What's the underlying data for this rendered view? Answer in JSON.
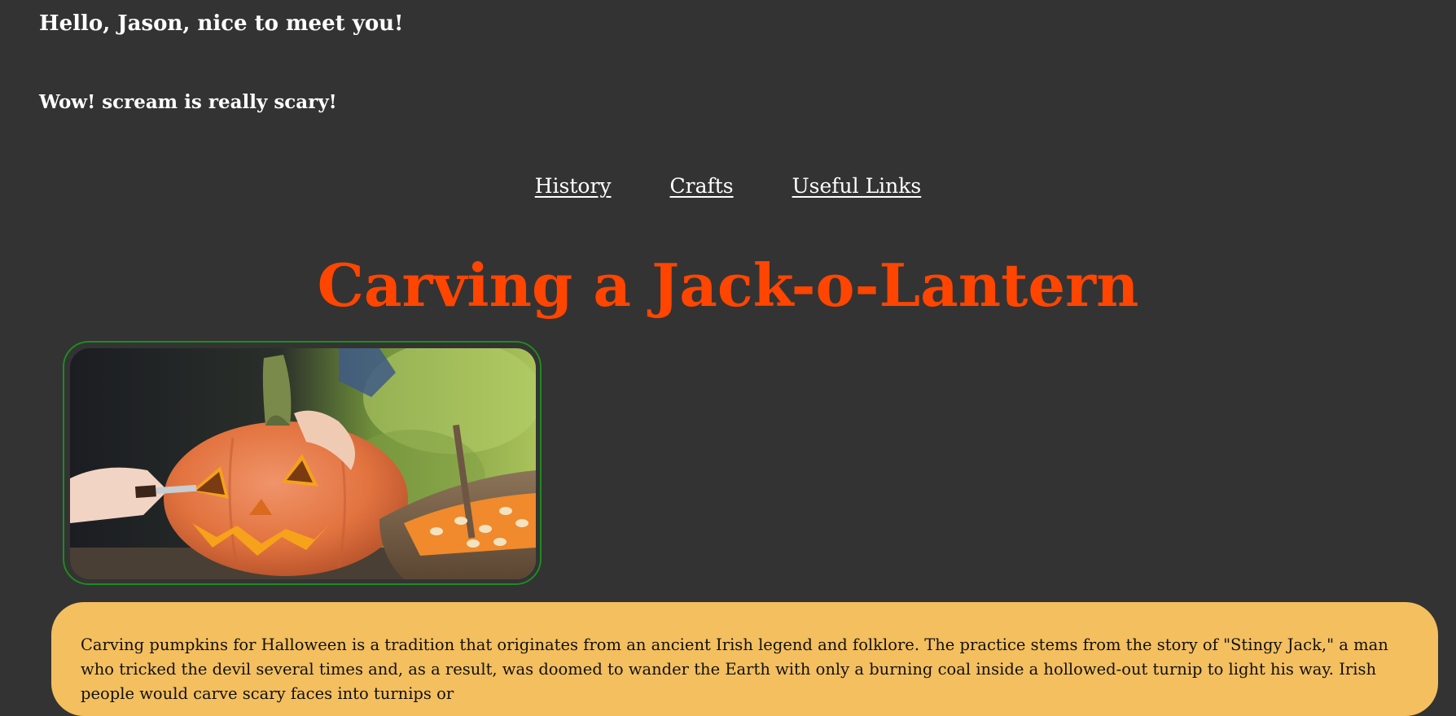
{
  "header": {
    "greeting": "Hello, Jason, nice to meet you!",
    "reaction": "Wow! scream is really scary!"
  },
  "nav": {
    "links": [
      {
        "label": "History"
      },
      {
        "label": "Crafts"
      },
      {
        "label": "Useful Links"
      }
    ]
  },
  "main": {
    "title": "Carving a Jack-o-Lantern",
    "image": {
      "subject": "hands carving a jack-o-lantern pumpkin with a knife beside a bowl of pumpkin seeds"
    },
    "paragraph": "Carving pumpkins for Halloween is a tradition that originates from an ancient Irish legend and folklore. The practice stems from the story of \"Stingy Jack,\" a man who tricked the devil several times and, as a result, was doomed to wander the Earth with only a burning coal inside a hollowed-out turnip to light his way. Irish people would carve scary faces into turnips or"
  },
  "colors": {
    "background": "#333333",
    "title": "#ff4500",
    "image_border": "#1f8a1f",
    "card": "#f4bf5f",
    "card_text": "#111111"
  }
}
